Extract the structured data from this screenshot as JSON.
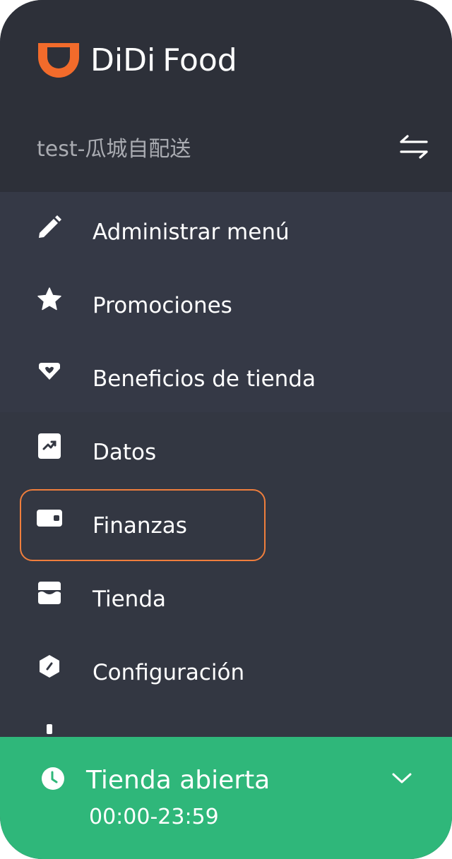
{
  "brand": {
    "logo_word_1": "DiDi",
    "logo_word_2": "Food",
    "logo_color": "#f26b2b"
  },
  "store": {
    "name": "test-瓜城自配送",
    "switch_icon": "switch-arrows-icon"
  },
  "menu": {
    "items": [
      {
        "label": "Administrar menú",
        "icon": "pencil-icon"
      },
      {
        "label": "Promociones",
        "icon": "star-icon"
      },
      {
        "label": "Beneficios de tienda",
        "icon": "heart-tag-icon"
      },
      {
        "label": "Datos",
        "icon": "chart-doc-icon"
      },
      {
        "label": "Finanzas",
        "icon": "wallet-icon",
        "selected": true
      },
      {
        "label": "Tienda",
        "icon": "storefront-icon"
      },
      {
        "label": "Configuración",
        "icon": "hexagon-gear-icon"
      }
    ]
  },
  "status": {
    "title": "Tienda abierta",
    "hours": "00:00-23:59",
    "color": "#2fb77a",
    "icon": "clock-icon",
    "expand_icon": "chevron-down-icon"
  },
  "colors": {
    "header_bg": "#2d3039",
    "menu_bg": "#333742",
    "highlight_border": "#f07e3c"
  }
}
